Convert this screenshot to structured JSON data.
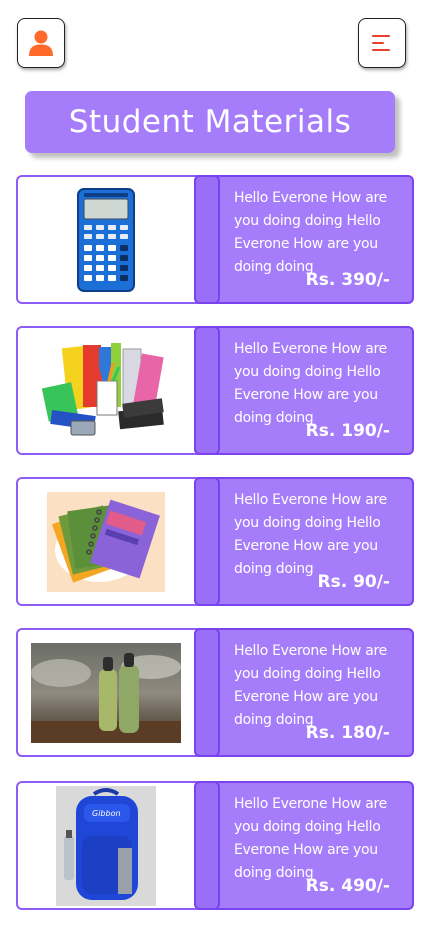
{
  "header": {
    "profile_icon": "user-icon",
    "menu_icon": "menu-lines-icon",
    "accent": "#ff5c2a"
  },
  "title": "Student Materials",
  "products": [
    {
      "image": "calculator-image",
      "description": "Hello Everone How are you doing doing Hello Everone How are you doing doing",
      "price": "Rs. 390/-"
    },
    {
      "image": "stationery-set-image",
      "description": "Hello Everone How are you doing doing Hello Everone How are you doing doing",
      "price": "Rs. 190/-"
    },
    {
      "image": "notebooks-image",
      "description": "Hello Everone How are you doing doing Hello Everone How are you doing doing",
      "price": "Rs. 90/-"
    },
    {
      "image": "water-bottles-image",
      "description": "Hello Everone How are you doing doing Hello Everone How are you doing doing",
      "price": "Rs. 180/-"
    },
    {
      "image": "backpack-image",
      "description": "Hello Everone How are you doing doing Hello Everone How are you doing doing",
      "price": "Rs. 490/-"
    }
  ],
  "colors": {
    "card_border": "#8e5cf6",
    "info_bg": "#a57dfb",
    "info_border": "#7b43ee"
  }
}
